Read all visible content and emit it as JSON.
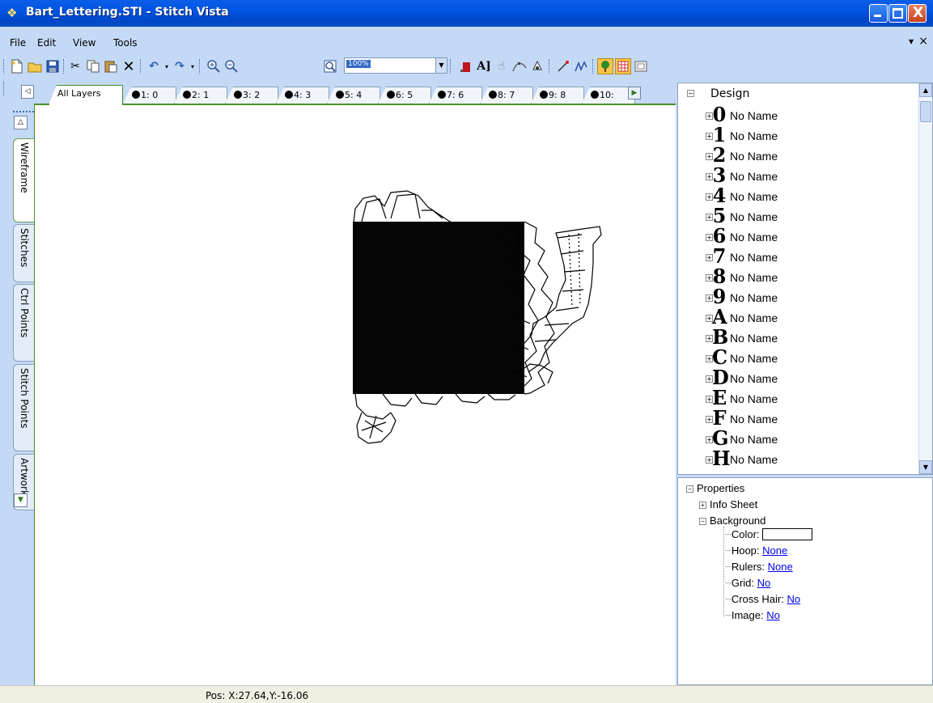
{
  "window": {
    "title": "Bart_Lettering.STI - Stitch Vista",
    "controls": {
      "minimize": "_",
      "maximize": "□",
      "close": "X"
    }
  },
  "menu": {
    "items": [
      "File",
      "Edit",
      "View",
      "Tools"
    ],
    "pin": "▾",
    "close": "×"
  },
  "toolbar": {
    "zoom": "100%",
    "icons": [
      "new-icon",
      "open-icon",
      "save-icon",
      "cut-icon",
      "copy-icon",
      "paste-icon",
      "delete-icon",
      "undo-icon",
      "redo-icon",
      "zoom-in-icon",
      "zoom-out-icon",
      "zoom-fit-icon",
      "fill-icon",
      "text-icon",
      "hand-icon",
      "curve-icon",
      "node-icon",
      "needle-icon",
      "stitch-icon",
      "tree-view-icon",
      "grid-view-icon",
      "preview-icon"
    ]
  },
  "layer_tabs": [
    "All Layers",
    "1: 0",
    "2: 1",
    "3: 2",
    "4: 3",
    "5: 4",
    "6: 5",
    "7: 6",
    "8: 7",
    "9: 8",
    "10:"
  ],
  "side_tabs": [
    "Wireframe",
    "Stitches",
    "Ctrl Points",
    "Stitch Points",
    "Artwork"
  ],
  "design_tree": {
    "header": "Design",
    "header_toggle": "−",
    "node_toggle": "+",
    "items": [
      {
        "glyph": "0",
        "label": "No Name"
      },
      {
        "glyph": "1",
        "label": "No Name"
      },
      {
        "glyph": "2",
        "label": "No Name"
      },
      {
        "glyph": "3",
        "label": "No Name"
      },
      {
        "glyph": "4",
        "label": "No Name"
      },
      {
        "glyph": "5",
        "label": "No Name"
      },
      {
        "glyph": "6",
        "label": "No Name"
      },
      {
        "glyph": "7",
        "label": "No Name"
      },
      {
        "glyph": "8",
        "label": "No Name"
      },
      {
        "glyph": "9",
        "label": "No Name"
      },
      {
        "glyph": "A",
        "label": "No Name"
      },
      {
        "glyph": "B",
        "label": "No Name"
      },
      {
        "glyph": "C",
        "label": "No Name"
      },
      {
        "glyph": "D",
        "label": "No Name"
      },
      {
        "glyph": "E",
        "label": "No Name"
      },
      {
        "glyph": "F",
        "label": "No Name"
      },
      {
        "glyph": "G",
        "label": "No Name"
      },
      {
        "glyph": "H",
        "label": "No Name"
      }
    ]
  },
  "properties": {
    "header": "Properties",
    "info_sheet": "Info Sheet",
    "background": "Background",
    "color_label": "Color:",
    "color_value": "#ffffff",
    "hoop_label": "Hoop:",
    "hoop_value": "None",
    "rulers_label": "Rulers:",
    "rulers_value": "None",
    "grid_label": "Grid:",
    "grid_value": "No",
    "crosshair_label": "Cross Hair:",
    "crosshair_value": "No",
    "image_label": "Image:",
    "image_value": "No"
  },
  "status": {
    "pos": "Pos: X:27.64,Y:-16.06"
  },
  "colors": {
    "chrome": "#c3d9f6",
    "titlebar": "#0054e3",
    "active_tab_border": "#4e8f2a"
  }
}
